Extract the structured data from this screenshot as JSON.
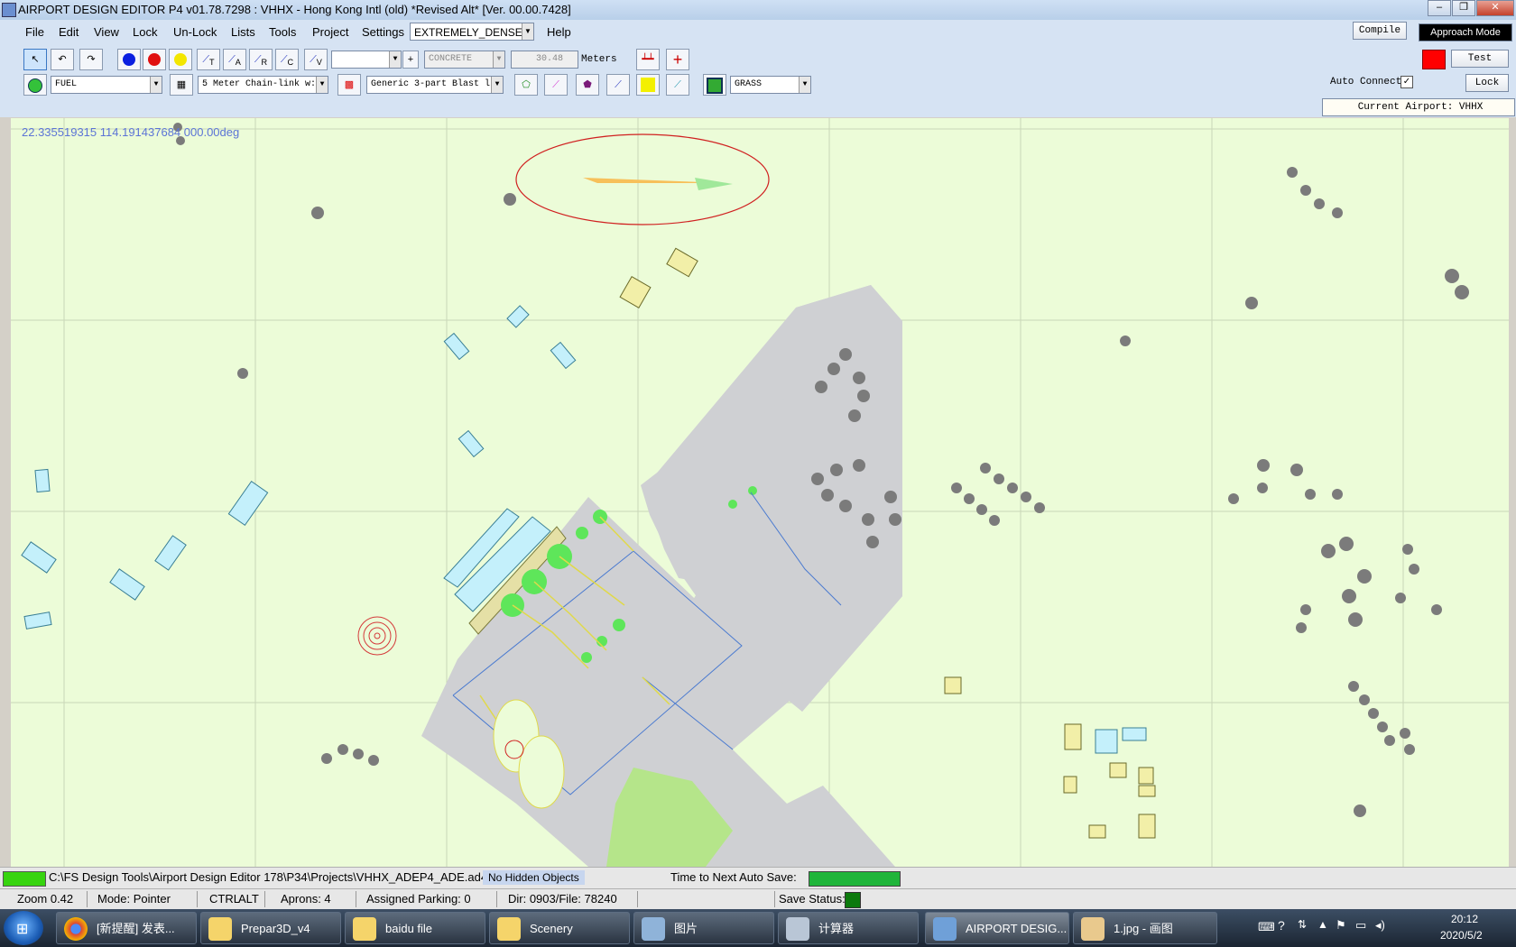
{
  "window": {
    "title": "AIRPORT DESIGN EDITOR P4  v01.78.7298 : VHHX - Hong Kong Intl (old) *Revised Alt*  [Ver. 00.00.7428]",
    "controls": [
      "‒",
      "❐",
      "✕"
    ]
  },
  "menu": {
    "items": [
      "File",
      "Edit",
      "View",
      "Lock",
      "Un-Lock",
      "Lists",
      "Tools",
      "Project",
      "Settings"
    ],
    "density": "EXTREMELY_DENSE",
    "help": "Help"
  },
  "toolbar": {
    "icons_row1": [
      "pointer-icon",
      "undo-icon",
      "redo-icon",
      "blue-node-icon",
      "red-node-icon",
      "yellow-node-icon",
      "taxi-link-icon",
      "apron-link-icon",
      "runway-link-icon",
      "c-link-icon",
      "v-link-icon"
    ],
    "link_labels": [
      "T",
      "A",
      "R",
      "C",
      "V"
    ],
    "surface_combo": "CONCRETE",
    "width_value": "30.48",
    "units": "Meters",
    "fuel_combo": "FUEL",
    "fence_combo": "5 Meter Chain-link w:",
    "blast_combo": "Generic 3-part Blast l",
    "grass_combo": "GRASS",
    "plus_glyph": "+"
  },
  "right_panel": {
    "compile": "Compile",
    "approach_mode": "Approach Mode",
    "test": "Test",
    "auto_connect_label": "Auto Connect",
    "auto_connect_checked": "✓",
    "lock": "Lock",
    "current_airport": "Current Airport: VHHX",
    "status_color": "#ff0000"
  },
  "map": {
    "coords": "22.335519315   114.191437684  000.00deg",
    "background": "#ecfcd8",
    "apron_color": "#cfd0d3"
  },
  "status1": {
    "path": "C:\\FS Design Tools\\Airport Design Editor 178\\P34\\Projects\\VHHX_ADEP4_ADE.ad4",
    "hidden": "No Hidden Objects",
    "autosave_label": "Time to Next Auto Save:"
  },
  "status2": {
    "zoom": "Zoom 0.42",
    "mode": "Mode: Pointer",
    "ctrl": "CTRL",
    "alt": "ALT",
    "aprons": "Aprons: 4",
    "parking": "Assigned Parking: 0",
    "dir": "Dir: 0903/File: 78240",
    "save": "Save Status:"
  },
  "taskbar": {
    "items": [
      {
        "label": "[新提醒] 发表...",
        "icon": "chrome-icon"
      },
      {
        "label": "Prepar3D_v4",
        "icon": "folder-icon"
      },
      {
        "label": "baidu file",
        "icon": "folder-icon"
      },
      {
        "label": "Scenery",
        "icon": "folder-icon"
      },
      {
        "label": "图片",
        "icon": "computer-icon"
      },
      {
        "label": "计算器",
        "icon": "calculator-icon"
      },
      {
        "label": "AIRPORT DESIG...",
        "icon": "ade-icon"
      },
      {
        "label": "1.jpg - 画图",
        "icon": "paint-icon"
      }
    ],
    "time": "20:12",
    "date": "2020/5/2"
  }
}
